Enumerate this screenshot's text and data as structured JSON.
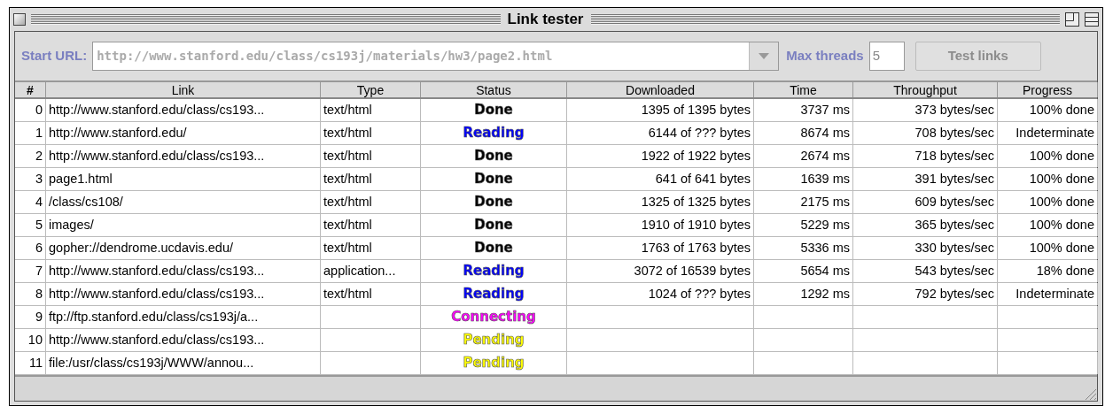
{
  "window": {
    "title": "Link tester"
  },
  "toolbar": {
    "start_url_label": "Start URL:",
    "start_url": "http://www.stanford.edu/class/cs193j/materials/hw3/page2.html",
    "start_url_disabled": true,
    "max_threads_label": "Max threads",
    "max_threads": "5",
    "test_button": "Test links",
    "test_button_disabled": true
  },
  "table": {
    "columns": [
      "#",
      "Link",
      "Type",
      "Status",
      "Downloaded",
      "Time",
      "Throughput",
      "Progress"
    ],
    "rows": [
      [
        "0",
        "http://www.stanford.edu/class/cs193...",
        "text/html",
        {
          "text": "Done",
          "color": "#000000"
        },
        "1395 of 1395 bytes",
        "3737 ms",
        "373 bytes/sec",
        "100% done"
      ],
      [
        "1",
        "http://www.stanford.edu/",
        "text/html",
        {
          "text": "Reading",
          "color": "#0000ff"
        },
        "6144 of ??? bytes",
        "8674 ms",
        "708 bytes/sec",
        "Indeterminate"
      ],
      [
        "2",
        "http://www.stanford.edu/class/cs193...",
        "text/html",
        {
          "text": "Done",
          "color": "#000000"
        },
        "1922 of 1922 bytes",
        "2674 ms",
        "718 bytes/sec",
        "100% done"
      ],
      [
        "3",
        "page1.html",
        "text/html",
        {
          "text": "Done",
          "color": "#000000"
        },
        "641 of 641 bytes",
        "1639 ms",
        "391 bytes/sec",
        "100% done"
      ],
      [
        "4",
        "/class/cs108/",
        "text/html",
        {
          "text": "Done",
          "color": "#000000"
        },
        "1325 of 1325 bytes",
        "2175 ms",
        "609 bytes/sec",
        "100% done"
      ],
      [
        "5",
        "images/",
        "text/html",
        {
          "text": "Done",
          "color": "#000000"
        },
        "1910 of 1910 bytes",
        "5229 ms",
        "365 bytes/sec",
        "100% done"
      ],
      [
        "6",
        "gopher://dendrome.ucdavis.edu/",
        "text/html",
        {
          "text": "Done",
          "color": "#000000"
        },
        "1763 of 1763 bytes",
        "5336 ms",
        "330 bytes/sec",
        "100% done"
      ],
      [
        "7",
        "http://www.stanford.edu/class/cs193...",
        "application...",
        {
          "text": "Reading",
          "color": "#0000ff"
        },
        "3072 of 16539 bytes",
        "5654 ms",
        "543 bytes/sec",
        "18% done"
      ],
      [
        "8",
        "http://www.stanford.edu/class/cs193...",
        "text/html",
        {
          "text": "Reading",
          "color": "#0000ff"
        },
        "1024 of ??? bytes",
        "1292 ms",
        "792 bytes/sec",
        "Indeterminate"
      ],
      [
        "9",
        "ftp://ftp.stanford.edu/class/cs193j/a...",
        null,
        {
          "text": "Connecting",
          "color": "#ff00ff"
        },
        null,
        null,
        null,
        null
      ],
      [
        "10",
        "http://www.stanford.edu/class/cs193...",
        null,
        {
          "text": "Pending",
          "color": "#ffff00"
        },
        null,
        null,
        null,
        null
      ],
      [
        "11",
        "file:/usr/class/cs193j/WWW/annou...",
        null,
        {
          "text": "Pending",
          "color": "#ffff00"
        },
        null,
        null,
        null,
        null
      ]
    ]
  }
}
